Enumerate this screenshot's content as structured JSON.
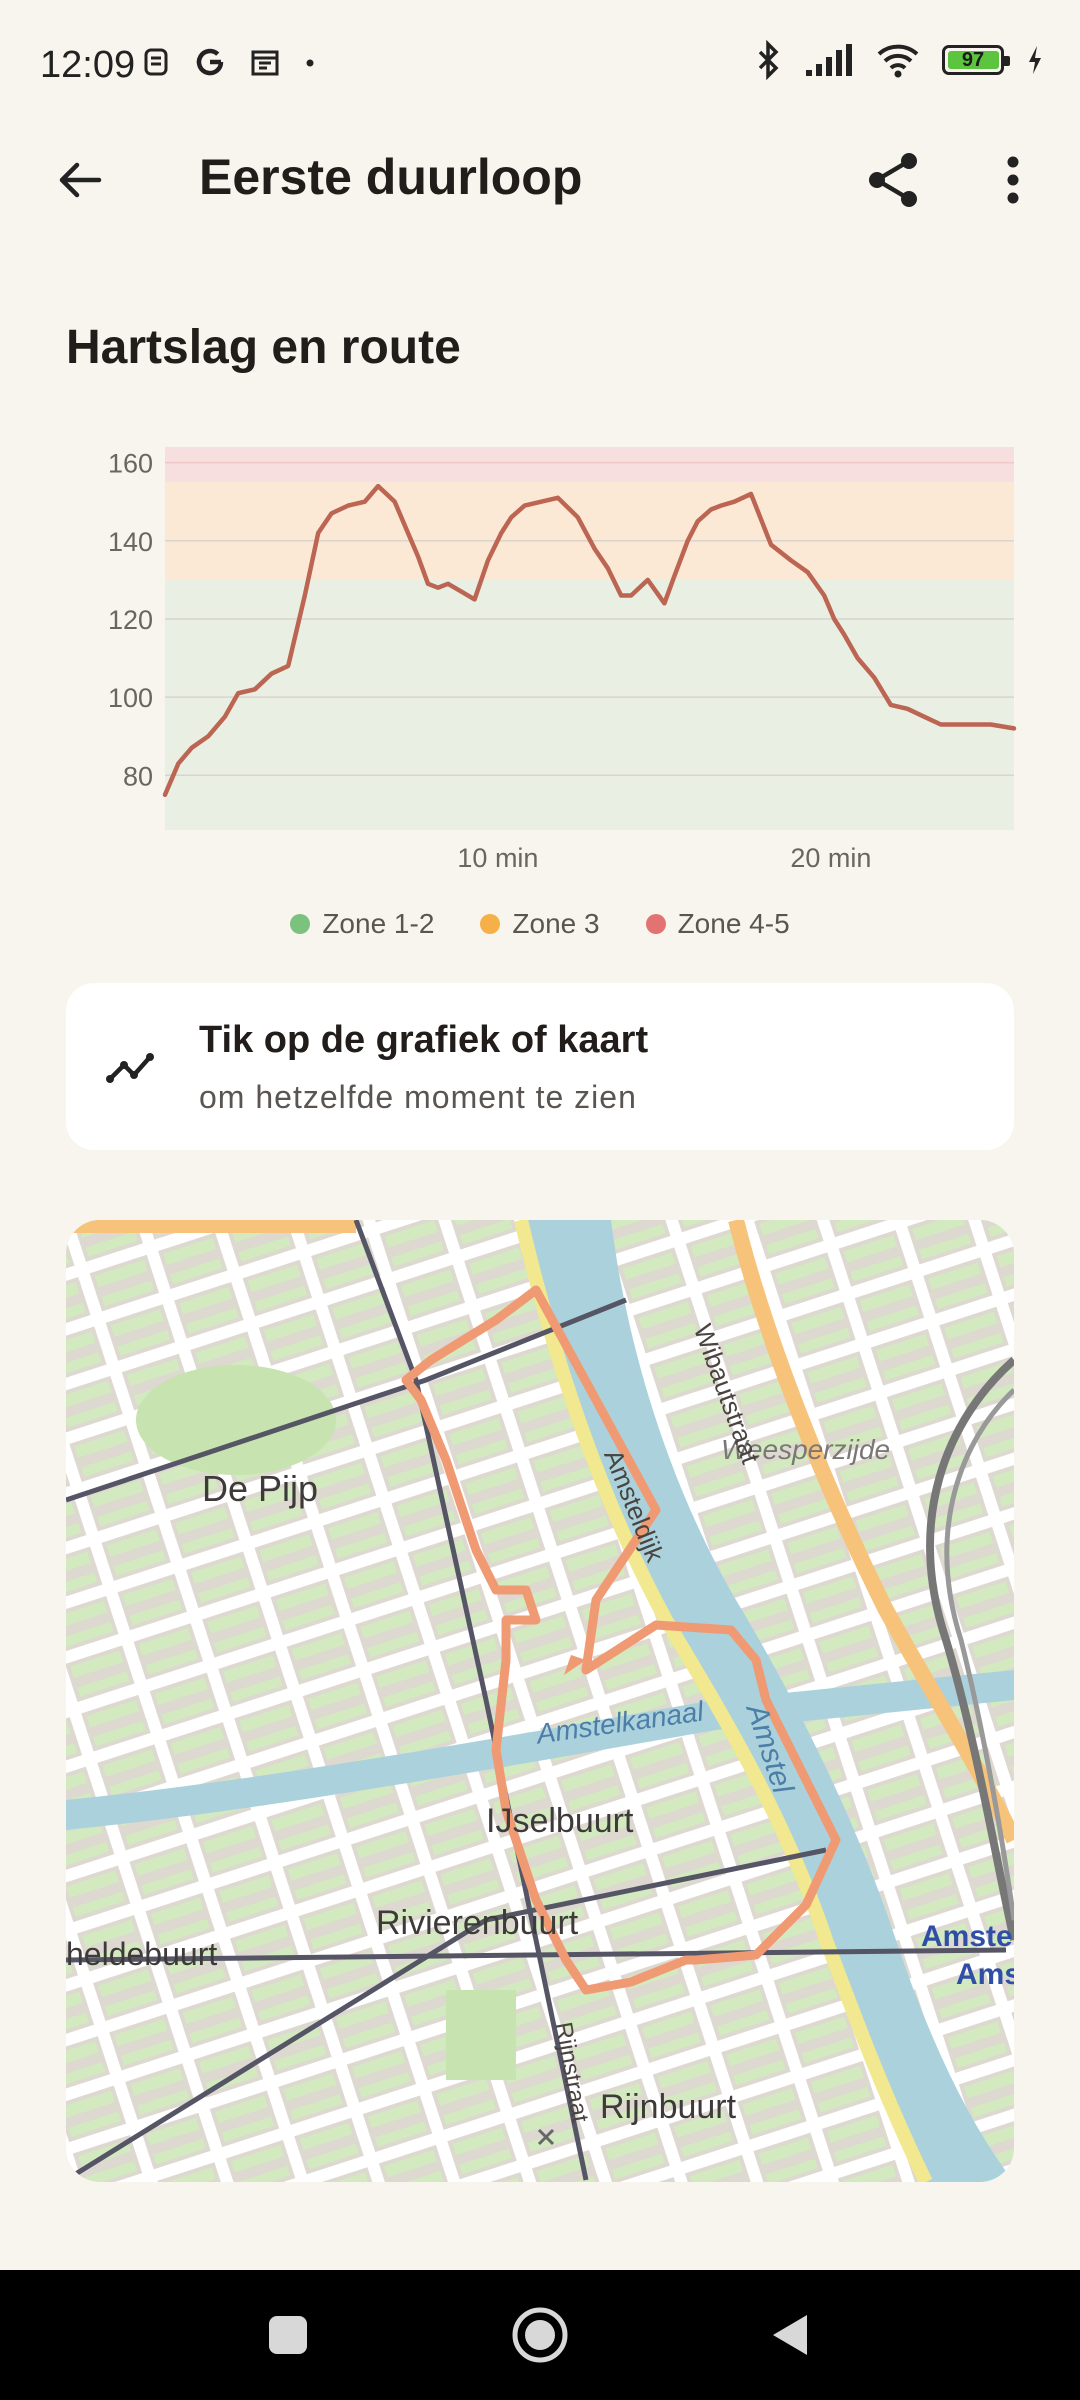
{
  "status_bar": {
    "time": "12:09",
    "battery_level": "97",
    "left_icons": [
      "sim-icon",
      "google-icon",
      "calendar-icon",
      "dot-icon"
    ],
    "right_icons": [
      "bluetooth-icon",
      "signal-icon",
      "wifi-icon",
      "battery-icon",
      "charging-icon"
    ]
  },
  "app_bar": {
    "title": "Eerste duurloop",
    "back_icon": "arrow-back-icon",
    "share_icon": "share-icon",
    "more_icon": "more-vertical-icon"
  },
  "section": {
    "title": "Hartslag en route"
  },
  "chart_data": {
    "type": "line",
    "title": "",
    "xlabel": "",
    "ylabel": "",
    "x_unit": "min",
    "x_tick_labels": [
      "10 min",
      "20 min"
    ],
    "x_ticks": [
      10,
      20
    ],
    "y_ticks": [
      80,
      100,
      120,
      140,
      160
    ],
    "xlim": [
      0,
      25.5
    ],
    "ylim": [
      66,
      164
    ],
    "zones": [
      {
        "name": "Zone 1-2",
        "from": 66,
        "to": 130,
        "color": "#e9efe2"
      },
      {
        "name": "Zone 3",
        "from": 130,
        "to": 155,
        "color": "#fbe9d6"
      },
      {
        "name": "Zone 4-5",
        "from": 155,
        "to": 164,
        "color": "#f8dfdf"
      }
    ],
    "line_color": "#bb6552",
    "series": [
      {
        "x": [
          0,
          0.4,
          0.8,
          1.3,
          1.8,
          2.2,
          2.7,
          3.2,
          3.7,
          4.2,
          4.6,
          5.0,
          5.5,
          6.0,
          6.4,
          6.9,
          7.3,
          7.6,
          7.9,
          8.2,
          8.5,
          8.9,
          9.3,
          9.7,
          10.1,
          10.4,
          10.8,
          11.3,
          11.8,
          12.4,
          12.9,
          13.3,
          13.7,
          14.0,
          14.5,
          15.0,
          15.3,
          15.7,
          16.0,
          16.4,
          16.7,
          17.1,
          17.6,
          18.2,
          18.8,
          19.3,
          19.8,
          20.1,
          20.4,
          20.8,
          21.3,
          21.8,
          22.3,
          22.8,
          23.3,
          23.8,
          24.3,
          24.8,
          25.5
        ],
        "y": [
          75,
          83,
          87,
          90,
          95,
          101,
          102,
          106,
          108,
          126,
          142,
          147,
          149,
          150,
          154,
          150,
          142,
          136,
          129,
          128,
          129,
          127,
          125,
          135,
          142,
          146,
          149,
          150,
          151,
          146,
          138,
          133,
          126,
          126,
          130,
          124,
          131,
          140,
          145,
          148,
          149,
          150,
          152,
          139,
          135,
          132,
          126,
          120,
          116,
          110,
          105,
          98,
          97,
          95,
          93,
          93,
          93,
          93,
          92
        ]
      }
    ],
    "legend": [
      "Zone 1-2",
      "Zone 3",
      "Zone 4-5"
    ],
    "legend_colors": [
      "#7cc27f",
      "#f6b04a",
      "#e37373"
    ],
    "legend_position": "bottom",
    "grid": true
  },
  "hint": {
    "title": "Tik op de grafiek of kaart",
    "subtitle": "om hetzelfde moment te zien",
    "icon": "trend-line-icon"
  },
  "map": {
    "labels": [
      "De Pijp",
      "Weesperzijde",
      "Wibautstraat",
      "Amsteldijk",
      "Amstelkanaal",
      "Amstel",
      "IJselbuurt",
      "Rivierenbuurt",
      "heldebuurt",
      "Rijnstraat",
      "Rijnbuurt",
      "Amste",
      "Ams"
    ],
    "route_color": "#ef9a72",
    "water_color": "#abd2dc"
  },
  "nav_bar": {
    "recent_icon": "square-recent-icon",
    "home_icon": "circle-home-icon",
    "back_icon": "triangle-back-icon"
  }
}
